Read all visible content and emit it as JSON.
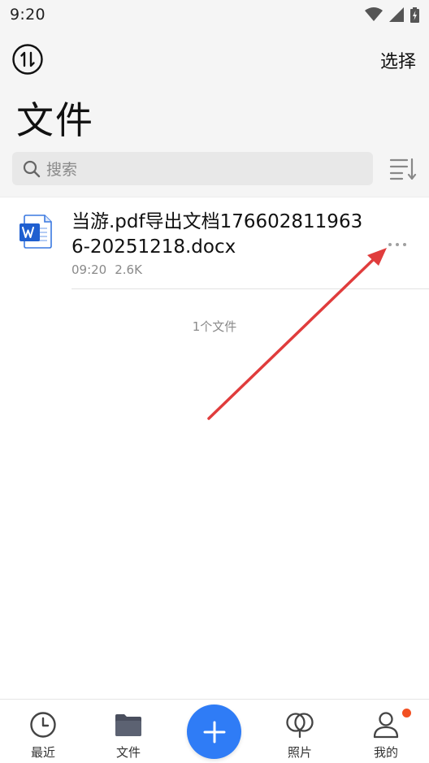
{
  "status_bar": {
    "time": "9:20"
  },
  "header": {
    "select_label": "选择",
    "title": "文件"
  },
  "search": {
    "placeholder": "搜索"
  },
  "files": [
    {
      "name": "当游.pdf导出文档1766028119636-20251218.docx",
      "time": "09:20",
      "size": "2.6K",
      "type_icon": "word-doc-icon"
    }
  ],
  "file_count": "1个文件",
  "bottom_nav": {
    "recent": "最近",
    "files": "文件",
    "photos": "照片",
    "me": "我的"
  },
  "colors": {
    "accent": "#2f7cf6",
    "annotation_arrow": "#e03c3c",
    "badge": "#f25022",
    "word_blue": "#1f5fd0"
  }
}
